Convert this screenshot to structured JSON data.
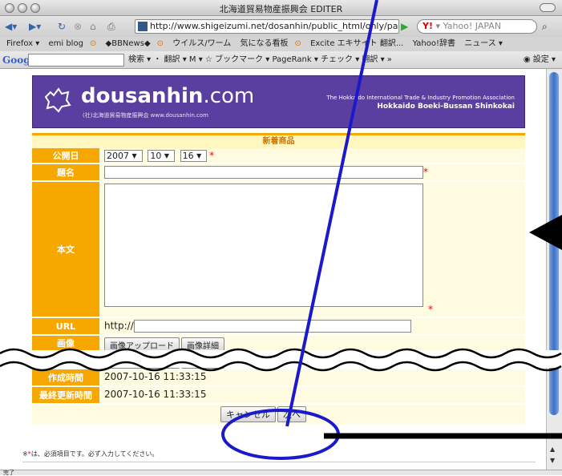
{
  "window": {
    "title": "北海道貿易物産振興会 EDITER"
  },
  "nav": {
    "url": "http://www.shigeizumi.net/dosanhin/public_html/only/partner/p",
    "yahoo": "Yahoo! JAPAN"
  },
  "bookmarks": [
    "Firefox ▾",
    "emi blog",
    "◆BBNews◆",
    "ウイルス/ワーム",
    "気になる看板",
    "Excite エキサイト 翻訳...",
    "Yahoo!辞書",
    "ニュース ▾"
  ],
  "google": {
    "logo": "Google",
    "items": "検索 ▾ ・ 翻訳 ▾ M ▾ ☆ ブックマーク ▾ PageRank ▾ チェック ▾ 翻訳 ▾ »",
    "settings": "設定 ▾"
  },
  "banner": {
    "logo_main": "dousanhin",
    "logo_suffix": ".com",
    "logo_sub": "(社)北海道貿易物産振興会 www.dousanhin.com",
    "right1": "The Hokkaido International Trade & Industry Promotion Association",
    "right2": "Hokkaido Boeki-Bussan Shinkokai"
  },
  "form": {
    "section_title": "新着商品",
    "date_label": "公開日",
    "year": "2007",
    "month": "10",
    "day": "16",
    "title_label": "題名",
    "body_label": "本文",
    "url_label": "URL",
    "url_value": "http://",
    "image_label": "画像",
    "upload_btn": "画像アップロード",
    "detail_btn": "画像詳細",
    "created_label": "作成時間",
    "created_value": "2007-10-16 11:33:15",
    "updated_label": "最終更新時間",
    "updated_value": "2007-10-16 11:33:15",
    "cancel_btn": "キャンセル",
    "next_btn": "次へ",
    "required_mark": "*",
    "footer_prefix": "※",
    "footer_note": "は、必須項目です。必ず入力してください。"
  },
  "status": {
    "text": "完了"
  }
}
